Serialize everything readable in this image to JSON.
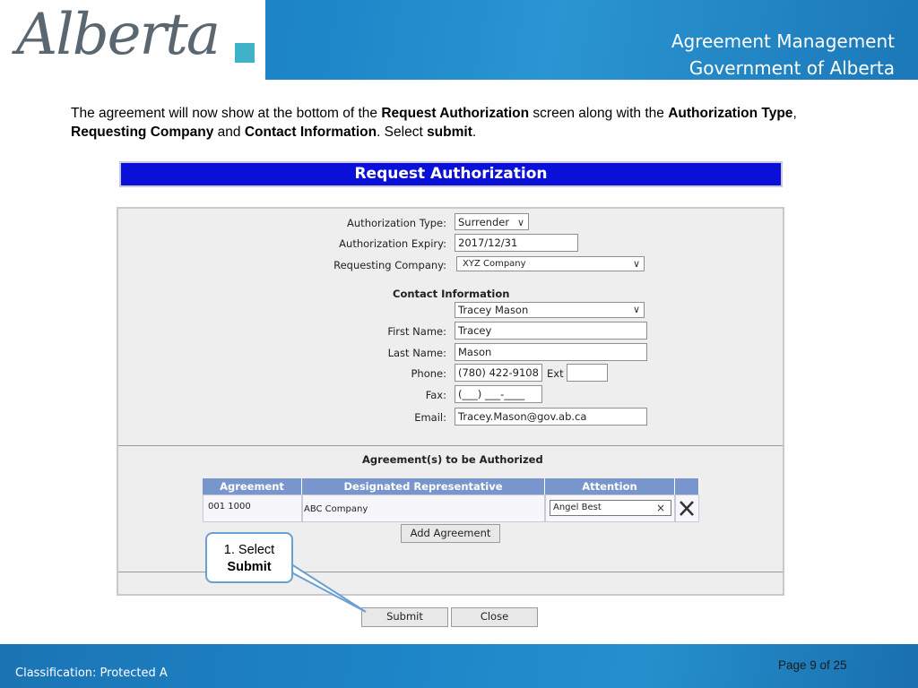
{
  "header": {
    "logo_text": "Alberta",
    "title_line1": "Agreement Management",
    "title_line2": "Government of Alberta"
  },
  "intro": {
    "t1": "The agreement will now show at the bottom of the ",
    "b1": "Request Authorization",
    "t2": " screen along with the ",
    "b2": "Authorization Type",
    "t3": ", ",
    "b3": "Requesting Company",
    "t4": " and ",
    "b4": "Contact Information",
    "t5": ".  Select ",
    "b5": "submit",
    "t6": "."
  },
  "form": {
    "title": "Request Authorization",
    "auth_type_label": "Authorization Type:",
    "auth_type_value": "Surrender",
    "auth_expiry_label": "Authorization Expiry:",
    "auth_expiry_value": "2017/12/31",
    "req_company_label": "Requesting Company:",
    "req_company_value": "XYZ Company",
    "contact_heading": "Contact Information",
    "contact_select_value": "Tracey Mason",
    "first_name_label": "First Name:",
    "first_name_value": "Tracey",
    "last_name_label": "Last Name:",
    "last_name_value": "Mason",
    "phone_label": "Phone:",
    "phone_value": "(780) 422-9108",
    "ext_label": "Ext",
    "ext_value": "",
    "fax_label": "Fax:",
    "fax_value": "(___) ___-____",
    "email_label": "Email:",
    "email_value": "Tracey.Mason@gov.ab.ca"
  },
  "agreements": {
    "heading": "Agreement(s) to be Authorized",
    "columns": [
      "Agreement",
      "Designated Representative",
      "Attention"
    ],
    "rows": [
      {
        "agreement": "001 1000",
        "representative": "ABC Company",
        "attention": "Angel Best"
      }
    ],
    "clear_glyph": "×",
    "add_button": "Add Agreement"
  },
  "buttons": {
    "submit": "Submit",
    "close": "Close"
  },
  "callout": {
    "line1": "1.  Select",
    "line2": "Submit"
  },
  "footer": {
    "classification": "Classification: Protected A",
    "page": "Page 9 of 25"
  },
  "colors": {
    "header_blue": "#1d86c8",
    "title_bar_blue": "#0a10d8",
    "table_header": "#7895cc"
  }
}
